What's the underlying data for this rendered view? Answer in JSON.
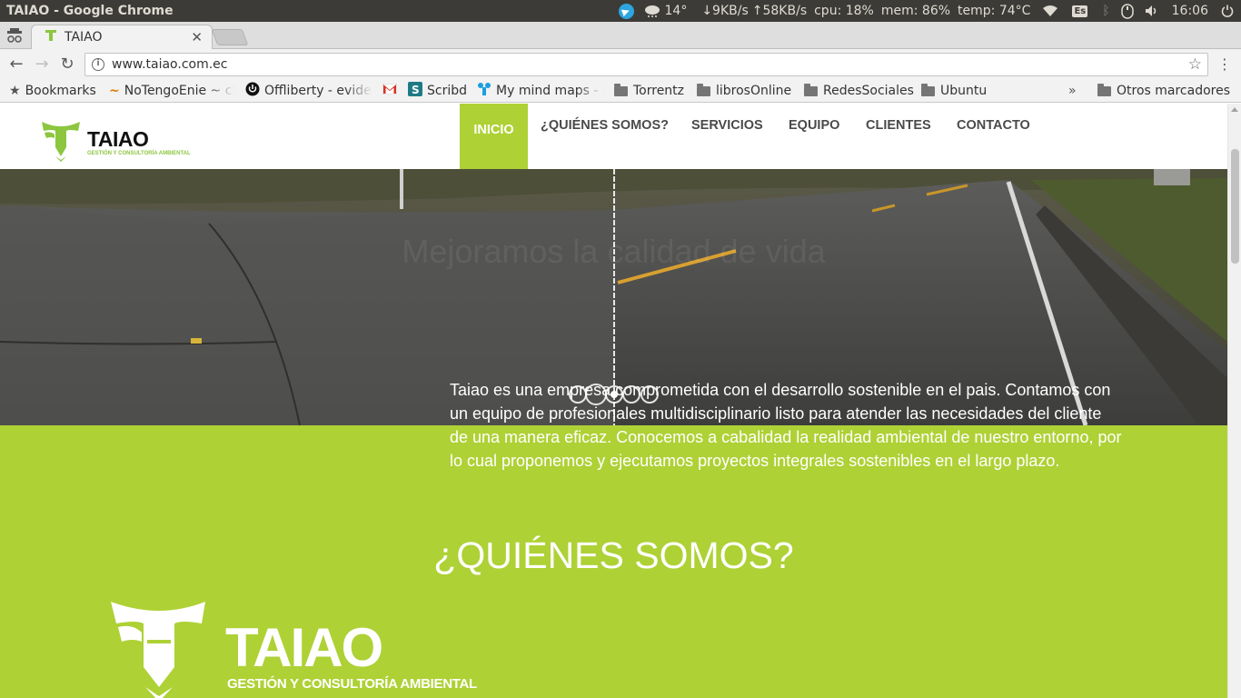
{
  "os_panel": {
    "window_title": "TAIAO - Google Chrome",
    "weather": "14°",
    "net_down": "↓9KB/s",
    "net_up": "↑58KB/s",
    "cpu": "cpu: 18%",
    "mem": "mem: 86%",
    "temp": "temp: 74°C",
    "keyboard": "Es",
    "clock": "16:06"
  },
  "browser": {
    "tab_title": "TAIAO",
    "url": "www.taiao.com.ec"
  },
  "bookmarks": [
    {
      "label": "Bookmarks",
      "icon": "star-icon"
    },
    {
      "label": "NoTengoEnie ~ cl",
      "icon": "notengoenie-icon"
    },
    {
      "label": "Offliberty - evide",
      "icon": "power-icon"
    },
    {
      "label": "",
      "icon": "gmail-icon"
    },
    {
      "label": "Scribd",
      "icon": "scribd-icon"
    },
    {
      "label": "My mind maps - N",
      "icon": "mindmaps-icon"
    },
    {
      "label": "Torrentz",
      "icon": "folder-icon"
    },
    {
      "label": "librosOnline",
      "icon": "folder-icon"
    },
    {
      "label": "RedesSociales",
      "icon": "folder-icon"
    },
    {
      "label": "Ubuntu",
      "icon": "folder-icon"
    }
  ],
  "bookmarks_overflow": "»",
  "other_bookmarks": "Otros marcadores",
  "site": {
    "logo_word": "TAIAO",
    "logo_tagline": "GESTIÓN Y CONSULTORÍA AMBIENTAL",
    "nav": [
      "INICIO",
      "¿QUIÉNES SOMOS?",
      "SERVICIOS",
      "EQUIPO",
      "CLIENTES",
      "CONTACTO"
    ],
    "hero_caption": "Mejoramos la calidad de vida",
    "slider_active_index": 2,
    "slider_count": 5,
    "about_title": "¿QUIÉNES SOMOS?",
    "about_text": "Taiao es una empresa comprometida con el desarrollo sostenible en el pais. Contamos con un equipo de profesionales multidisciplinario listo para atender las necesidades del cliente de una manera eficaz. Conocemos a cabalidad la realidad ambiental de nuestro entorno, por lo cual proponemos y ejecutamos proyectos integrales sostenibles en el largo plazo."
  },
  "colors": {
    "brand_green": "#aed135",
    "os_panel": "#3c3b37"
  }
}
